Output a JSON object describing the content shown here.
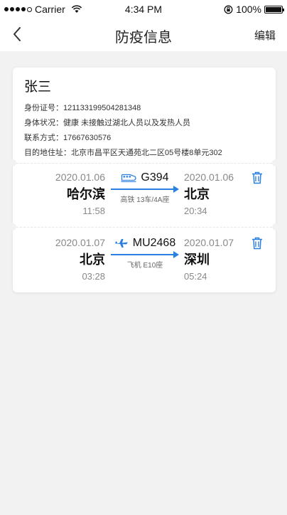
{
  "status_bar": {
    "carrier": "Carrier",
    "time": "4:34 PM",
    "battery": "100%"
  },
  "nav": {
    "title": "防疫信息",
    "edit_label": "编辑"
  },
  "person": {
    "name": "张三",
    "id_label": "身份证号：",
    "id_value": "121133199504281348",
    "health_label": "身体状况：",
    "health_value": "健康 未接触过湖北人员以及发热人员",
    "contact_label": "联系方式：",
    "contact_value": "17667630576",
    "address_label": "目的地住址：",
    "address_value": "北京市昌平区天通苑北二区05号楼8单元302"
  },
  "trips": [
    {
      "mode_icon": "train-icon",
      "code": "G394",
      "depart_date": "2020.01.06",
      "depart_city": "哈尔滨",
      "depart_time": "11:58",
      "arrive_date": "2020.01.06",
      "arrive_city": "北京",
      "arrive_time": "20:34",
      "detail": "高铁  13车/4A座"
    },
    {
      "mode_icon": "plane-icon",
      "code": "MU2468",
      "depart_date": "2020.01.07",
      "depart_city": "北京",
      "depart_time": "03:28",
      "arrive_date": "2020.01.07",
      "arrive_city": "深圳",
      "arrive_time": "05:24",
      "detail": "飞机  E10座"
    }
  ],
  "colors": {
    "accent": "#2b7fe0",
    "background": "#f2f2f2"
  }
}
